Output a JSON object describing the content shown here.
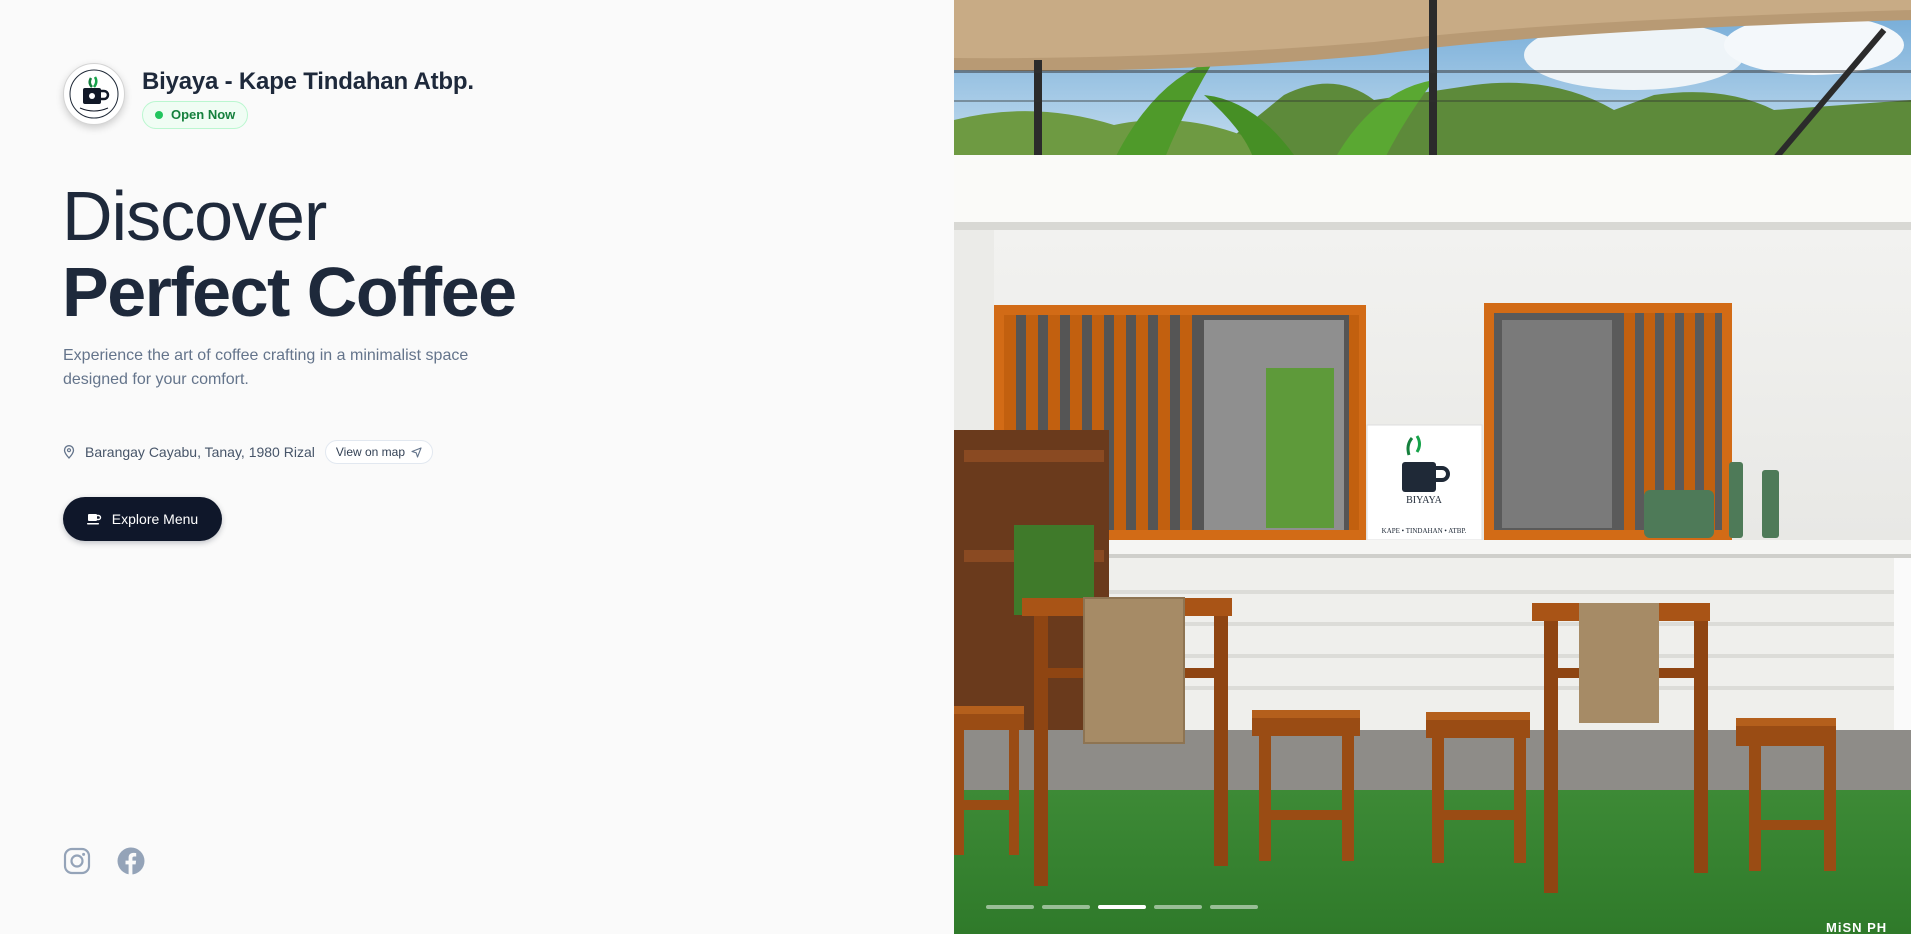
{
  "brand": {
    "name": "Biyaya - Kape Tindahan Atbp.",
    "logo_icon": "coffee-cup-logo-icon",
    "status_label": "Open Now",
    "status_color": "#22c55e"
  },
  "hero": {
    "headline_light": "Discover",
    "headline_bold": "Perfect Coffee",
    "subtitle": "Experience the art of coffee crafting in a minimalist space designed for your comfort."
  },
  "location": {
    "address": "Barangay Cayabu, Tanay, 1980 Rizal",
    "map_label": "View on map",
    "pin_icon": "map-pin-icon",
    "map_icon": "navigation-arrow-icon"
  },
  "cta": {
    "label": "Explore Menu",
    "icon": "coffee-cup-icon",
    "color": "#0f172a"
  },
  "social": [
    {
      "name": "Instagram",
      "icon": "instagram-icon"
    },
    {
      "name": "Facebook",
      "icon": "facebook-icon"
    }
  ],
  "carousel": {
    "total": 5,
    "active_index": 2
  },
  "photo": {
    "logo_text_1": "BIYAYA",
    "logo_text_2": "KAPE • TINDAHAN • ATBP.",
    "watermark": "MiSN PH"
  },
  "colors": {
    "accent_dark": "#0f172a",
    "text_primary": "#1e293b",
    "text_muted": "#64748b",
    "wood": "#b45309"
  }
}
